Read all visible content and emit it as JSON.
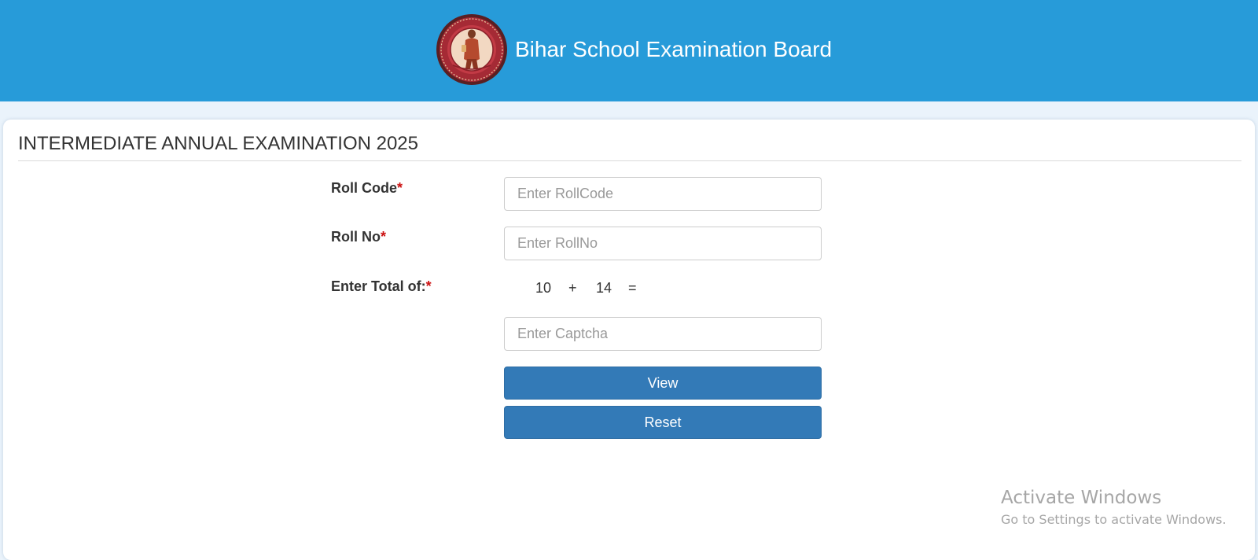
{
  "header": {
    "title": "Bihar School Examination Board",
    "logo_icon": "bseb-seal-icon"
  },
  "form": {
    "heading": "INTERMEDIATE ANNUAL EXAMINATION 2025",
    "required_marker": "*",
    "roll_code": {
      "label": "Roll Code",
      "placeholder": "Enter RollCode",
      "value": ""
    },
    "roll_no": {
      "label": "Roll No",
      "placeholder": "Enter RollNo",
      "value": ""
    },
    "captcha": {
      "label": "Enter Total of:",
      "operand_a": "10",
      "operator": "+",
      "operand_b": "14",
      "equals": "=",
      "placeholder": "Enter Captcha",
      "value": ""
    },
    "view_label": "View",
    "reset_label": "Reset"
  },
  "watermark": {
    "title": "Activate Windows",
    "subtitle": "Go to Settings to activate Windows."
  },
  "colors": {
    "header_bg": "#279bd9",
    "button_bg": "#337ab7",
    "required": "#cc1111"
  }
}
